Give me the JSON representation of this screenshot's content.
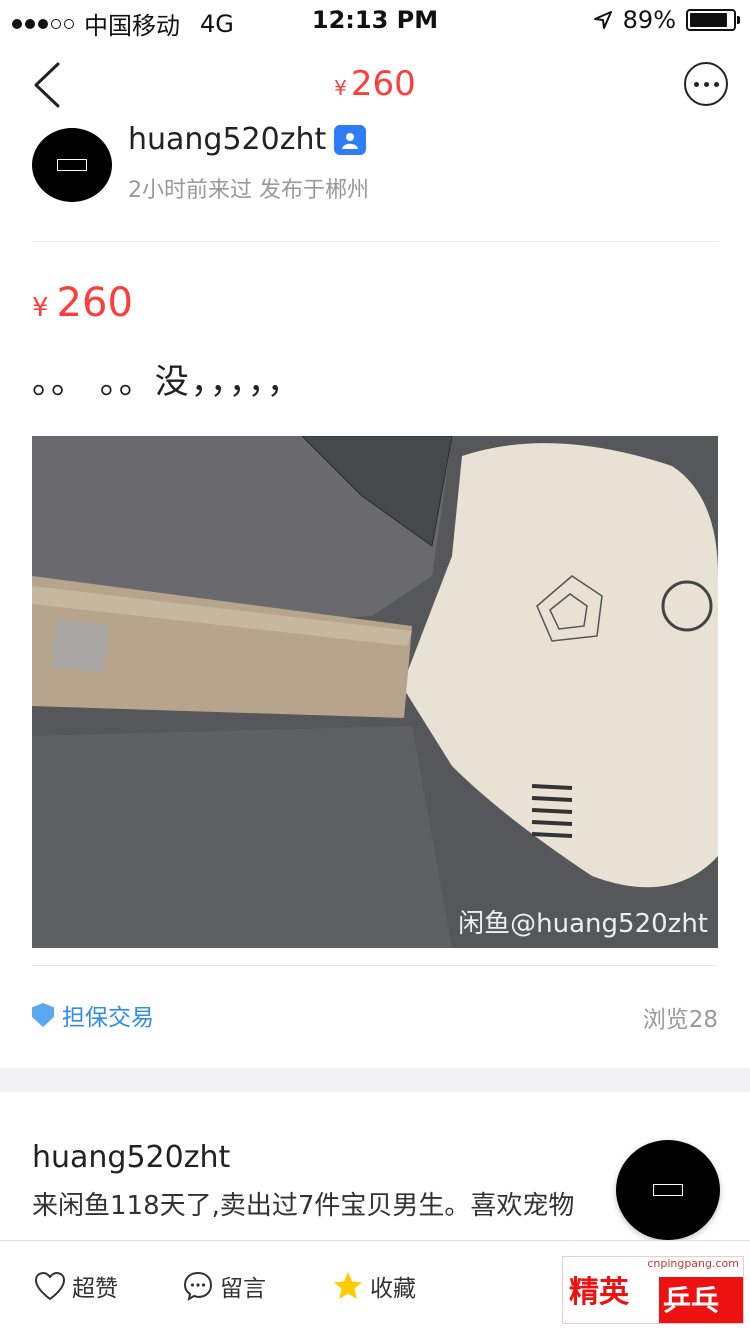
{
  "status_bar": {
    "carrier": "中国移动",
    "network": "4G",
    "time": "12:13 PM",
    "battery": "89%",
    "battery_level": 0.89
  },
  "nav": {
    "currency": "¥",
    "price": "260"
  },
  "seller": {
    "name": "huang520zht",
    "meta": "2小时前来过 发布于郴州"
  },
  "item": {
    "currency": "¥",
    "price": "260",
    "description": "。。 。。没，，，，，",
    "photo_watermark": "闲鱼@huang520zht"
  },
  "trust": {
    "label": "担保交易",
    "views": "浏览28"
  },
  "bio": {
    "name": "huang520zht",
    "text": "来闲鱼118天了,卖出过7件宝贝男生。喜欢宠物"
  },
  "bottom_bar": {
    "like": "超赞",
    "comment": "留言",
    "favorite": "收藏"
  },
  "ad": {
    "url": "cnpingpang.com",
    "left": "精英",
    "right": "乒乓网"
  },
  "colors": {
    "price": "#ff3b3b",
    "link": "#2e8ee8",
    "star": "#ffcc00"
  }
}
